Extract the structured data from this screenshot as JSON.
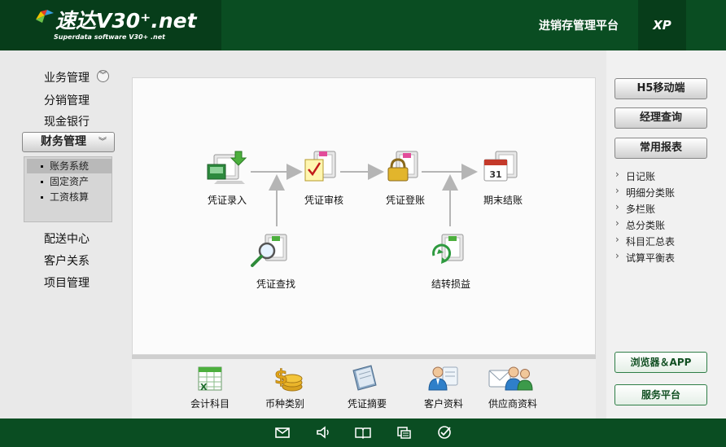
{
  "header": {
    "logo_title": "速达V30⁺.net",
    "logo_subtitle": "Superdata software V30+ .net",
    "platform": "进销存管理平台",
    "edition": "XP"
  },
  "left_nav": {
    "items_top": [
      "业务管理",
      "分销管理",
      "现金银行"
    ],
    "active": "财务管理",
    "sub_items": [
      "账务系统",
      "固定资产",
      "工资核算"
    ],
    "items_bottom": [
      "配送中心",
      "客户关系",
      "项目管理"
    ]
  },
  "flow": {
    "voucher_entry": "凭证录入",
    "voucher_audit": "凭证审核",
    "voucher_post": "凭证登账",
    "period_close": "期末结账",
    "voucher_query": "凭证查找",
    "carry_forward": "结转损益"
  },
  "tools": [
    "会计科目",
    "币种类别",
    "凭证摘要",
    "客户资料",
    "供应商资料"
  ],
  "right_panel": {
    "buttons": [
      "H5移动端",
      "经理查询",
      "常用报表"
    ],
    "reports": [
      "日记账",
      "明细分类账",
      "多栏账",
      "总分类账",
      "科目汇总表",
      "试算平衡表"
    ],
    "bottom_buttons": [
      "浏览器＆APP",
      "服务平台"
    ]
  },
  "colors": {
    "header_green": "#0a4d22",
    "logo_green": "#073d1a",
    "accent_green": "#2e7d46"
  },
  "footer_icons": [
    "mail-icon",
    "speaker-icon",
    "book-icon",
    "window-icon",
    "check-circle-icon"
  ]
}
